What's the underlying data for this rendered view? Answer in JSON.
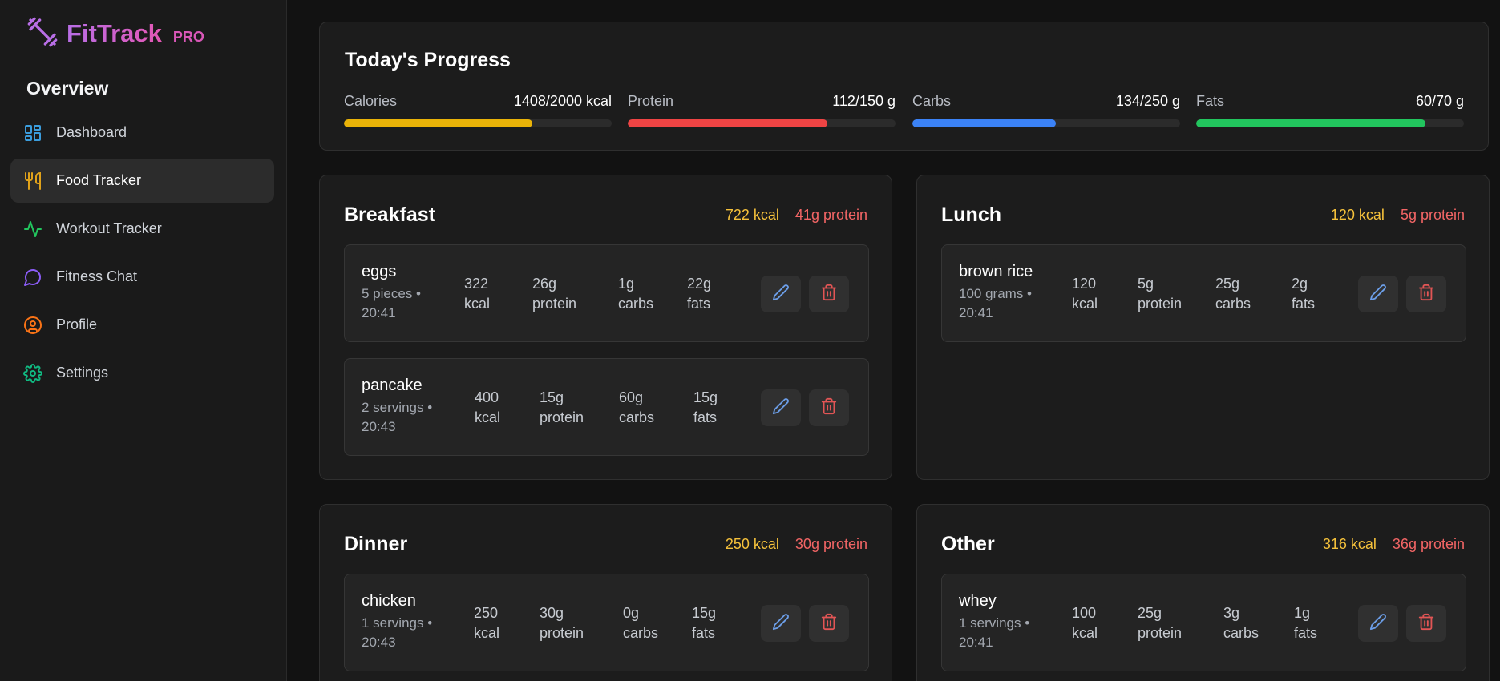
{
  "brand": {
    "name": "FitTrack",
    "badge": "PRO"
  },
  "sidebar": {
    "section_title": "Overview",
    "items": [
      {
        "label": "Dashboard",
        "icon": "dashboard-icon",
        "color": "#3b9ddd",
        "active": false
      },
      {
        "label": "Food Tracker",
        "icon": "utensils-icon",
        "color": "#e0a21a",
        "active": true
      },
      {
        "label": "Workout Tracker",
        "icon": "activity-icon",
        "color": "#22c55e",
        "active": false
      },
      {
        "label": "Fitness Chat",
        "icon": "chat-icon",
        "color": "#8b5cf6",
        "active": false
      },
      {
        "label": "Profile",
        "icon": "user-circle-icon",
        "color": "#f97316",
        "active": false
      },
      {
        "label": "Settings",
        "icon": "gear-icon",
        "color": "#10b981",
        "active": false
      }
    ]
  },
  "progress": {
    "title": "Today's Progress",
    "metrics": [
      {
        "label": "Calories",
        "value": "1408/2000 kcal",
        "fraction": 0.704,
        "color": "#eab308"
      },
      {
        "label": "Protein",
        "value": "112/150 g",
        "fraction": 0.747,
        "color": "#ef4444"
      },
      {
        "label": "Carbs",
        "value": "134/250 g",
        "fraction": 0.536,
        "color": "#3b82f6"
      },
      {
        "label": "Fats",
        "value": "60/70 g",
        "fraction": 0.857,
        "color": "#22c55e"
      }
    ]
  },
  "meals": {
    "breakfast": {
      "title": "Breakfast",
      "kcal": "722 kcal",
      "protein": "41g protein",
      "items": [
        {
          "name": "eggs",
          "meta": "5 pieces • 20:41",
          "kcal": "322 kcal",
          "protein": "26g protein",
          "carbs": "1g carbs",
          "fats": "22g fats"
        },
        {
          "name": "pancake",
          "meta": "2 servings • 20:43",
          "kcal": "400 kcal",
          "protein": "15g protein",
          "carbs": "60g carbs",
          "fats": "15g fats"
        }
      ]
    },
    "lunch": {
      "title": "Lunch",
      "kcal": "120 kcal",
      "protein": "5g protein",
      "items": [
        {
          "name": "brown rice",
          "meta": "100 grams • 20:41",
          "kcal": "120 kcal",
          "protein": "5g protein",
          "carbs": "25g carbs",
          "fats": "2g fats"
        }
      ]
    },
    "dinner": {
      "title": "Dinner",
      "kcal": "250 kcal",
      "protein": "30g protein",
      "items": [
        {
          "name": "chicken",
          "meta": "1 servings • 20:43",
          "kcal": "250 kcal",
          "protein": "30g protein",
          "carbs": "0g carbs",
          "fats": "15g fats"
        }
      ]
    },
    "other": {
      "title": "Other",
      "kcal": "316 kcal",
      "protein": "36g protein",
      "items": [
        {
          "name": "whey",
          "meta": "1 servings • 20:41",
          "kcal": "100 kcal",
          "protein": "25g protein",
          "carbs": "3g carbs",
          "fats": "1g fats"
        }
      ]
    }
  },
  "colors": {
    "edit": "#6c9ee8",
    "delete": "#e25555"
  }
}
